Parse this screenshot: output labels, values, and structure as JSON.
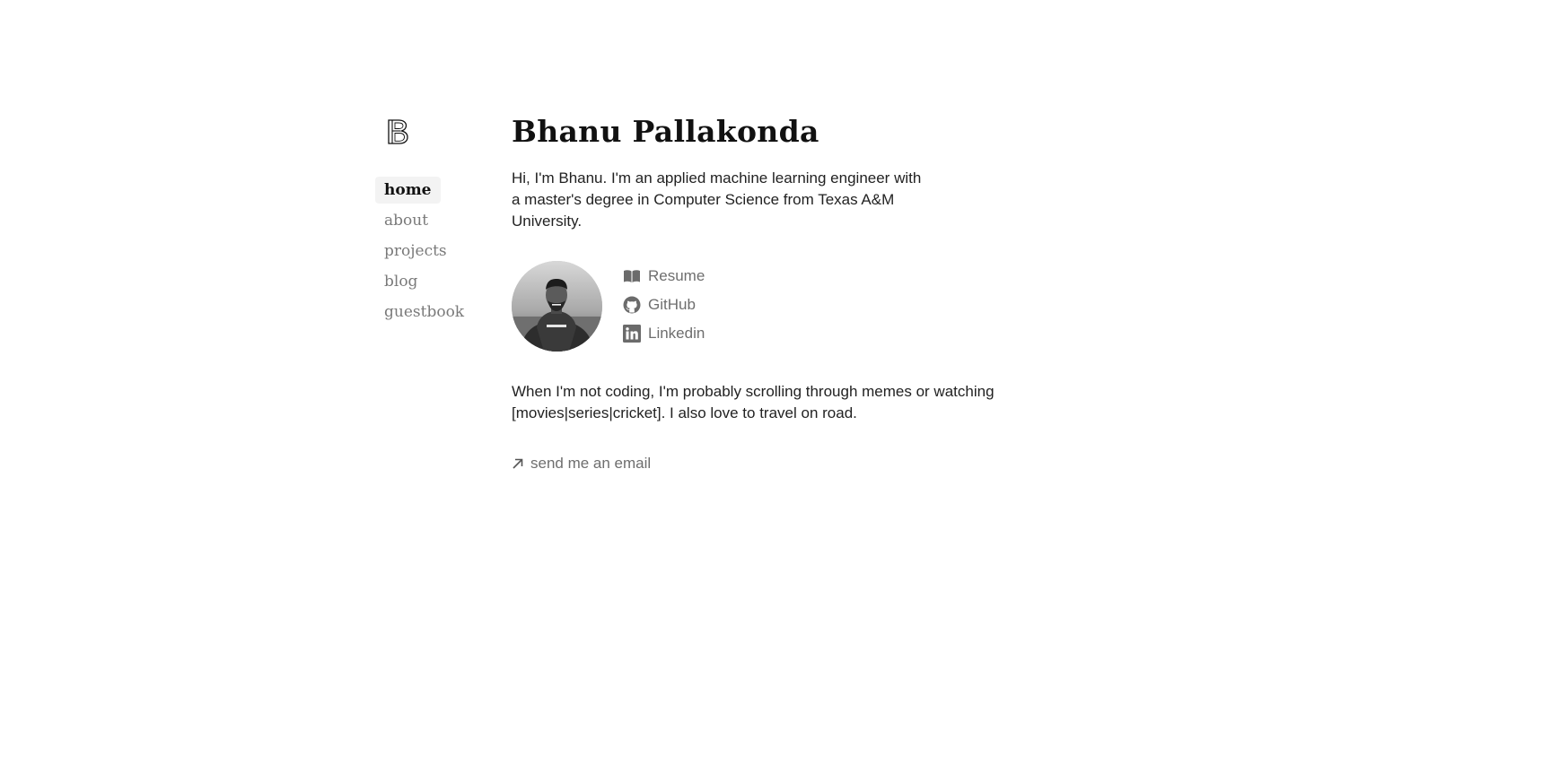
{
  "sidebar": {
    "logo_letter": "B",
    "nav": [
      {
        "label": "home",
        "active": true
      },
      {
        "label": "about",
        "active": false
      },
      {
        "label": "projects",
        "active": false
      },
      {
        "label": "blog",
        "active": false
      },
      {
        "label": "guestbook",
        "active": false
      }
    ]
  },
  "main": {
    "title": "Bhanu Pallakonda",
    "intro": "Hi, I'm Bhanu. I'm an applied machine learning engineer with a master's degree in Computer Science from Texas A&M University.",
    "links": [
      {
        "label": "Resume",
        "icon": "book-icon"
      },
      {
        "label": "GitHub",
        "icon": "github-icon"
      },
      {
        "label": "Linkedin",
        "icon": "linkedin-icon"
      }
    ],
    "outro": "When I'm not coding, I'm probably scrolling through memes or watching [movies|series|cricket]. I also love to travel on road.",
    "email_label": "send me an email",
    "email_icon": "arrow-up-right-icon"
  },
  "colors": {
    "text": "#222222",
    "muted": "#6e6e6e",
    "nav_active_bg": "#f3f3f3",
    "icon_fill": "#6b6b6b"
  }
}
